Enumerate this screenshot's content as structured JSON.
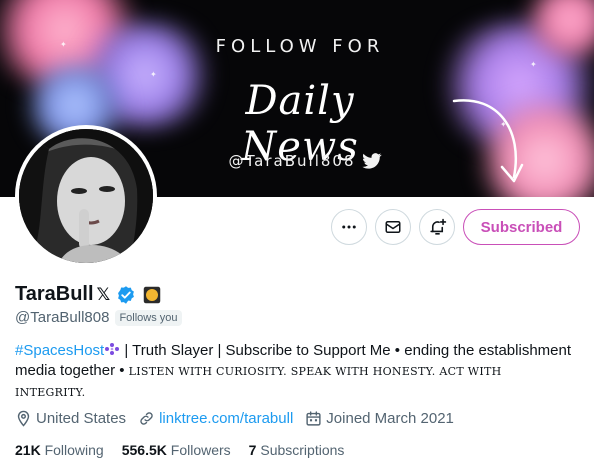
{
  "banner": {
    "line1": "FOLLOW FOR",
    "line2": "Daily News",
    "handle": "@TaraBull808"
  },
  "actions": {
    "more_icon": "more-icon",
    "message_icon": "envelope-icon",
    "notify_icon": "bell-plus-icon",
    "subscribed_label": "Subscribed"
  },
  "profile": {
    "display_name": "TaraBull",
    "x_mark": "𝕏",
    "handle": "@TaraBull808",
    "follows_you": "Follows you",
    "bio_hashtag": "#SpacesHost",
    "bio_text": " | Truth Slayer | Subscribe to Support Me • ending the establishment media together • ",
    "bio_caps": "LISTEN WITH CURIOSITY. SPEAK WITH HONESTY. ACT WITH INTEGRITY."
  },
  "meta": {
    "location": "United States",
    "link": "linktree.com/tarabull",
    "joined": "Joined March 2021"
  },
  "stats": {
    "following_count": "21K",
    "following_label": "Following",
    "followers_count": "556.5K",
    "followers_label": "Followers",
    "subscriptions_count": "7",
    "subscriptions_label": "Subscriptions"
  },
  "colors": {
    "accent": "#1d9bf0",
    "subscribe": "#c94fb8",
    "verified": "#1d9bf0",
    "gold_badge": "#f2b631"
  }
}
